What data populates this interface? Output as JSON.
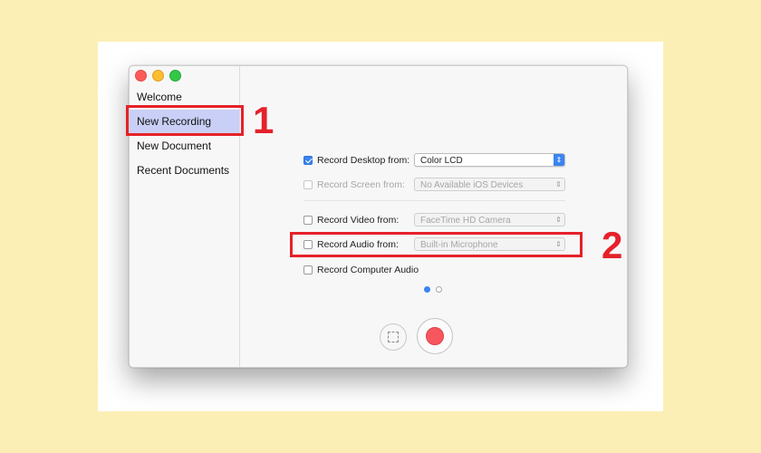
{
  "sidebar": {
    "items": [
      {
        "label": "Welcome"
      },
      {
        "label": "New Recording"
      },
      {
        "label": "New Document"
      },
      {
        "label": "Recent Documents"
      }
    ]
  },
  "options": {
    "record_desktop": {
      "label": "Record Desktop from:",
      "value": "Color LCD",
      "checked": true
    },
    "record_screen": {
      "label": "Record Screen from:",
      "value": "No Available iOS Devices",
      "checked": false
    },
    "record_video": {
      "label": "Record Video from:",
      "value": "FaceTime HD Camera",
      "checked": false
    },
    "record_audio": {
      "label": "Record Audio from:",
      "value": "Built-in Microphone",
      "checked": false
    },
    "record_computer_audio": {
      "label": "Record Computer Audio",
      "checked": false
    }
  },
  "pagination": {
    "current": 1,
    "total": 2
  },
  "annotations": {
    "one": "1",
    "two": "2"
  },
  "colors": {
    "background": "#fcefb6",
    "accent": "#3b84f0",
    "annotation": "#e5212a",
    "record": "#f8565f",
    "selected_item": "#c9cff6"
  }
}
